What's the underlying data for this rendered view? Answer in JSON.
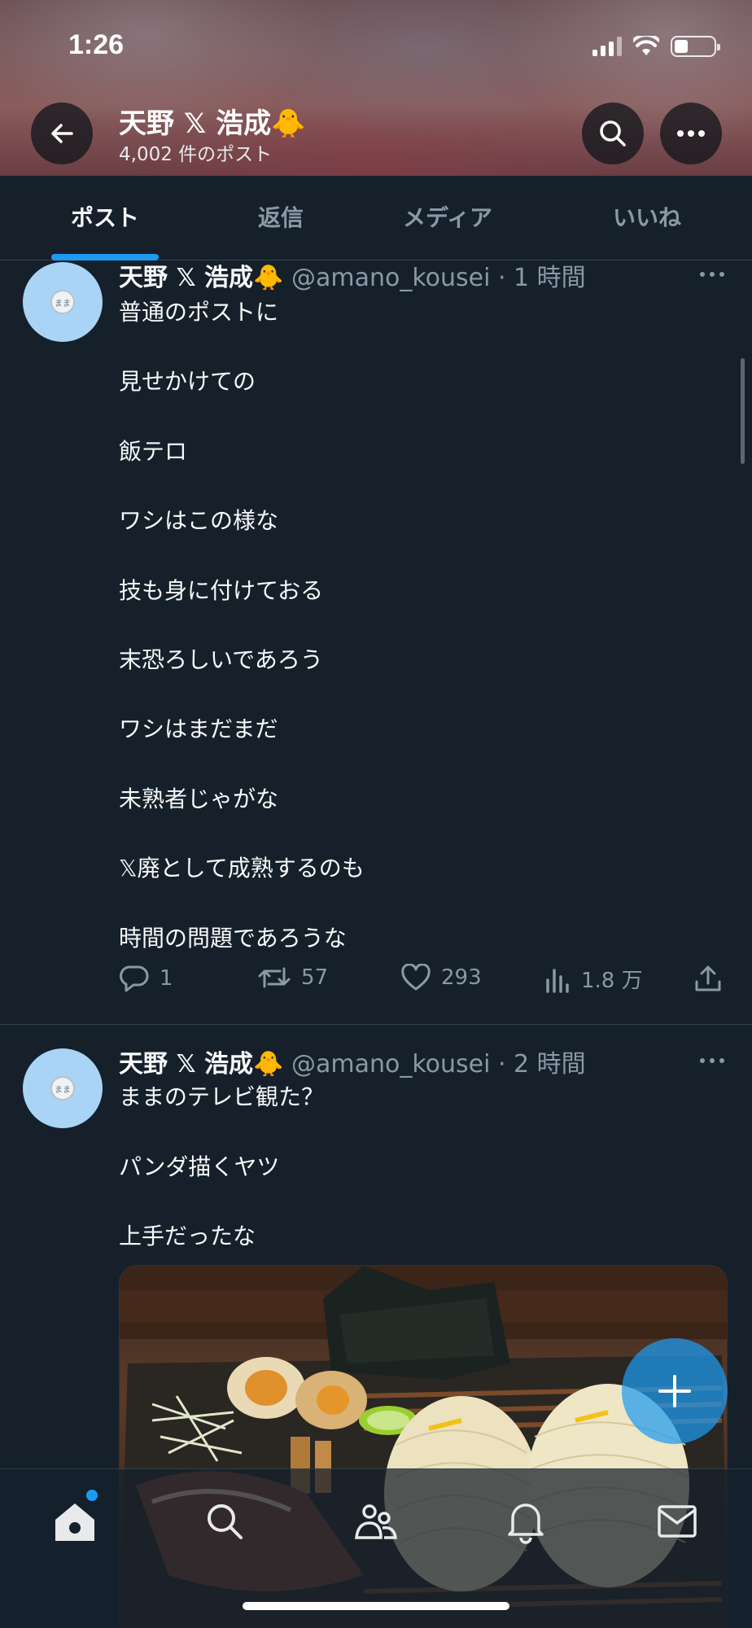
{
  "status_bar": {
    "time": "1:26",
    "battery_level": 0.35
  },
  "header": {
    "title": "天野 𝕏 浩成🐥",
    "subtitle": "4,002 件のポスト"
  },
  "tabs": [
    {
      "label": "ポスト",
      "active": true
    },
    {
      "label": "返信",
      "active": false
    },
    {
      "label": "メディア",
      "active": false
    },
    {
      "label": "いいね",
      "active": false
    }
  ],
  "posts": [
    {
      "name": "天野 𝕏 浩成🐥",
      "handle": "@amano_kousei · 1 時間",
      "avatar_text": "まま",
      "lines": [
        "普通のポストに",
        "見せかけての",
        "飯テロ",
        "ワシはこの様な",
        "技も身に付けておる",
        "末恐ろしいであろう",
        "ワシはまだまだ",
        "未熟者じゃがな",
        "𝕏廃として成熟するのも",
        "時間の問題であろうな"
      ],
      "replies": "1",
      "reposts": "57",
      "likes": "293",
      "views": "1.8 万"
    },
    {
      "name": "天野 𝕏 浩成🐥",
      "handle": "@amano_kousei · 2 時間",
      "avatar_text": "まま",
      "lines": [
        "ままのテレビ観た？",
        "パンダ描くヤツ",
        "上手だったな"
      ]
    }
  ],
  "colors": {
    "background": "#15202b",
    "accent": "#1d9bf0",
    "muted": "#8b98a5",
    "text": "#f7f9f9"
  },
  "icons": [
    "back-arrow-icon",
    "search-icon",
    "more-icon",
    "reply-icon",
    "repost-icon",
    "like-icon",
    "views-icon",
    "share-icon",
    "compose-plus-icon",
    "home-icon",
    "communities-icon",
    "notifications-icon",
    "messages-icon"
  ]
}
